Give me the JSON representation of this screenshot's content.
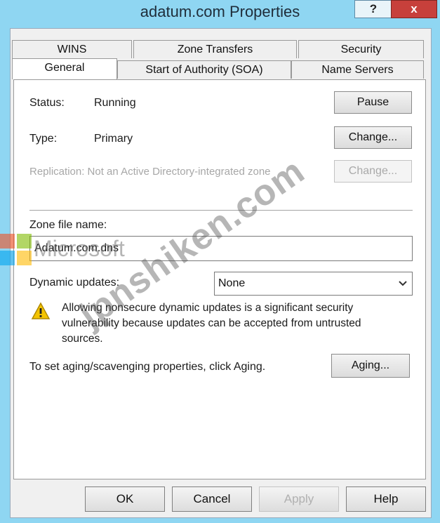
{
  "window": {
    "title": "adatum.com Properties",
    "help_label": "?",
    "close_label": "x"
  },
  "tabs": {
    "row1": [
      "WINS",
      "Zone Transfers",
      "Security"
    ],
    "row2": [
      "General",
      "Start of Authority (SOA)",
      "Name Servers"
    ],
    "active": "General"
  },
  "general": {
    "status_label": "Status:",
    "status_value": "Running",
    "pause_button": "Pause",
    "type_label": "Type:",
    "type_value": "Primary",
    "type_change_button": "Change...",
    "replication_text": "Replication: Not an Active Directory-integrated zone",
    "replication_change_button": "Change...",
    "zone_file_label": "Zone file name:",
    "zone_file_value": "Adatum.com.dns",
    "dynamic_updates_label": "Dynamic updates:",
    "dynamic_updates_value": "None",
    "warning_line1": "Allowing nonsecure dynamic updates is a significant security",
    "warning_line2": "vulnerability because updates can be accepted from untrusted",
    "warning_line3": "sources.",
    "aging_text": "To set aging/scavenging properties, click Aging.",
    "aging_button": "Aging..."
  },
  "footer": {
    "ok": "OK",
    "cancel": "Cancel",
    "apply": "Apply",
    "help": "Help"
  },
  "watermark": {
    "logo_text": "Microsoft",
    "site_text": "jpnshiken.com"
  },
  "colors": {
    "title_bar": "#8fd6f2",
    "close_button": "#c7403b",
    "warning_yellow": "#f4c400"
  },
  "icons": {
    "warning": "warning-icon",
    "dropdown": "chevron-down-icon"
  }
}
